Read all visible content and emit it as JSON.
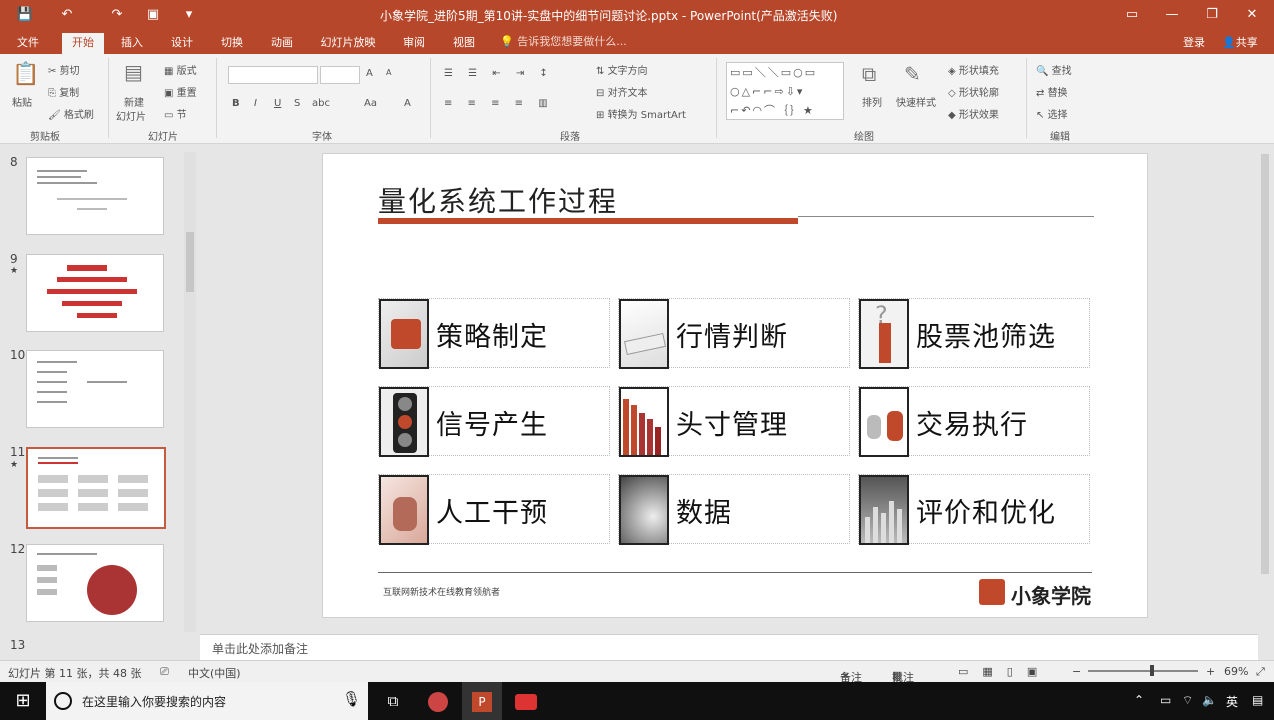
{
  "titlebar": {
    "title": "小象学院_进阶5期_第10讲-实盘中的细节问题讨论.pptx - PowerPoint(产品激活失败)",
    "save_icon": "save-icon",
    "undo_icon": "undo-icon",
    "redo_icon": "redo-icon",
    "present_icon": "present-icon"
  },
  "tabs": [
    "文件",
    "开始",
    "插入",
    "设计",
    "切换",
    "动画",
    "幻灯片放映",
    "审阅",
    "视图"
  ],
  "active_tab": "开始",
  "tell_me": "告诉我您想要做什么...",
  "account": {
    "login": "登录",
    "share": "共享"
  },
  "ribbon": {
    "clipboard": {
      "paste": "粘贴",
      "cut": "剪切",
      "copy": "复制",
      "format_painter": "格式刷",
      "group": "剪贴板"
    },
    "slides": {
      "new_slide": "新建",
      "new_slide2": "幻灯片",
      "layout": "版式",
      "reset": "重置",
      "section": "节",
      "group": "幻灯片"
    },
    "font": {
      "group": "字体",
      "bold": "B",
      "italic": "I",
      "underline": "U",
      "strike": "S",
      "spacing": "abc",
      "case": "Aa",
      "color": "A",
      "grow": "A",
      "shrink": "A"
    },
    "paragraph": {
      "group": "段落",
      "text_direction": "文字方向",
      "align_text": "对齐文本",
      "smartart": "转换为 SmartArt"
    },
    "drawing": {
      "group": "绘图",
      "arrange": "排列",
      "quick_styles": "快速样式",
      "fill": "形状填充",
      "outline": "形状轮廓",
      "effects": "形状效果"
    },
    "editing": {
      "group": "编辑",
      "find": "查找",
      "replace": "替换",
      "select": "选择"
    }
  },
  "thumbnails": [
    {
      "num": "8",
      "star": ""
    },
    {
      "num": "9",
      "star": "★"
    },
    {
      "num": "10",
      "star": ""
    },
    {
      "num": "11",
      "star": "★"
    },
    {
      "num": "12",
      "star": ""
    },
    {
      "num": "13",
      "star": ""
    }
  ],
  "slide": {
    "title": "量化系统工作过程",
    "cards": [
      {
        "label": "策略制定",
        "icon": "puzzle-icon"
      },
      {
        "label": "行情判断",
        "icon": "forecast-icon"
      },
      {
        "label": "股票池筛选",
        "icon": "question-icon"
      },
      {
        "label": "信号产生",
        "icon": "traffic-light-icon"
      },
      {
        "label": "头寸管理",
        "icon": "bars-icon"
      },
      {
        "label": "交易执行",
        "icon": "people-icon"
      },
      {
        "label": "人工干预",
        "icon": "hand-icon"
      },
      {
        "label": "数据",
        "icon": "data-icon"
      },
      {
        "label": "评价和优化",
        "icon": "chart-icon"
      }
    ],
    "footer": "互联网新技术在线教育领航者",
    "logo_text": "小象学院"
  },
  "notes": "单击此处添加备注",
  "status": {
    "slide_info": "幻灯片 第 11 张，共 48 张",
    "language": "中文(中国)",
    "notes_btn": "备注",
    "comments_btn": "批注",
    "zoom": "69%"
  },
  "taskbar": {
    "search_placeholder": "在这里输入你要搜索的内容",
    "ime": "英"
  },
  "colors": {
    "accent": "#b7472a",
    "title_bar": "#c0492b"
  }
}
